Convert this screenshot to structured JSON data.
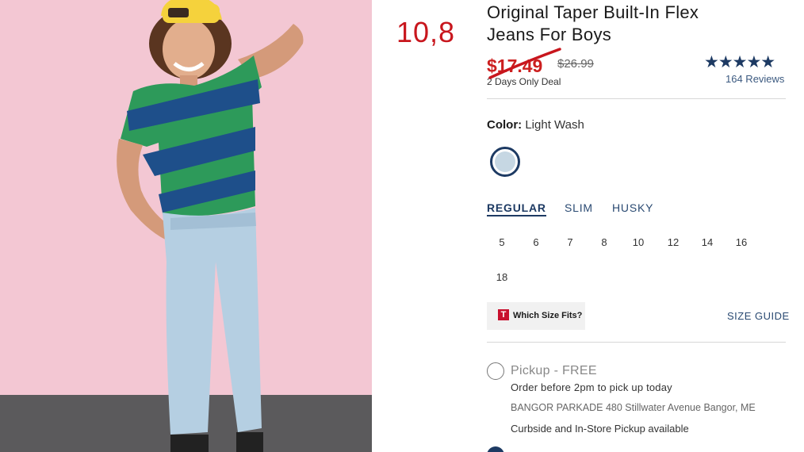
{
  "product": {
    "title_line1": "Original Taper Built-In Flex",
    "title_line2": "Jeans For Boys",
    "sale_price": "$17.49",
    "original_price": "$26.99",
    "deal_text": "2 Days Only Deal",
    "rating_stars": "★★★★★",
    "reviews_label": "164 Reviews"
  },
  "annotation": {
    "handwritten_price": "10,8",
    "color": "#c8161d"
  },
  "color_selector": {
    "label": "Color:",
    "selected_value": "Light Wash",
    "swatch_color": "#c6d7e3"
  },
  "fit_tabs": [
    {
      "label": "REGULAR",
      "active": true
    },
    {
      "label": "SLIM",
      "active": false
    },
    {
      "label": "HUSKY",
      "active": false
    }
  ],
  "sizes": [
    "5",
    "6",
    "7",
    "8",
    "10",
    "12",
    "14",
    "16",
    "18"
  ],
  "size_help": {
    "which_size_logo": "T",
    "which_size_label": "Which Size Fits?",
    "size_guide_label": "SIZE GUIDE"
  },
  "fulfillment": {
    "pickup_title": "Pickup - FREE",
    "pickup_note": "Order before 2pm to pick up today",
    "store_name": "BANGOR PARKADE",
    "store_address": "480 Stillwater Avenue",
    "store_city": "Bangor, ME",
    "curbside_note": "Curbside and In-Store Pickup available"
  },
  "colors": {
    "brand_navy": "#1d3a63",
    "sale_red": "#cc1f1f",
    "backdrop_pink": "#f3c7d3"
  }
}
